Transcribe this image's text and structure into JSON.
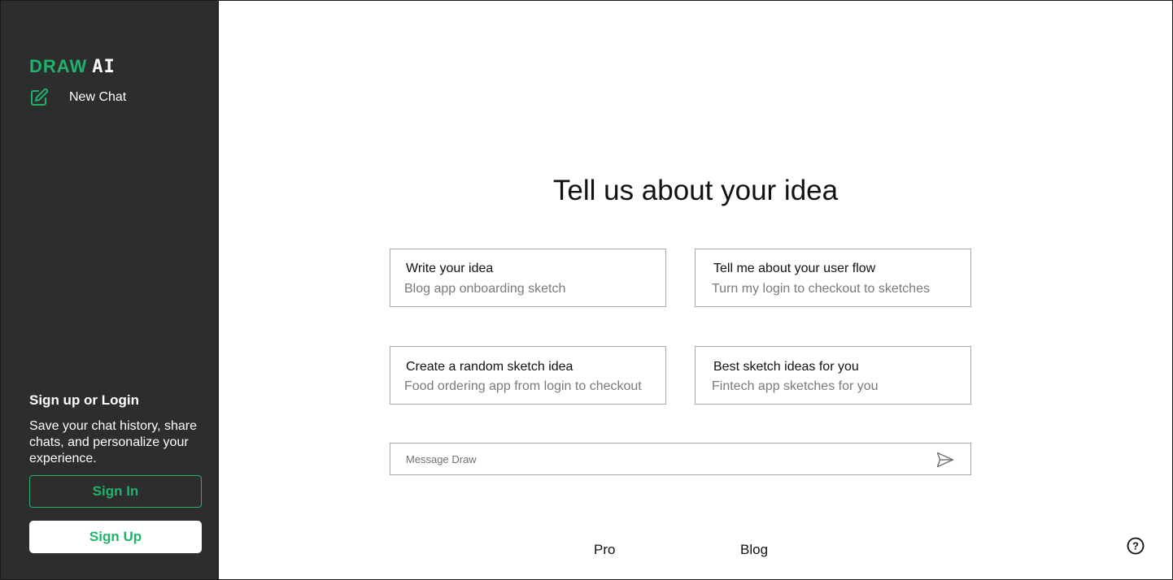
{
  "sidebar": {
    "logo_primary": "DRAW",
    "logo_secondary": "AI",
    "new_chat_label": "New Chat",
    "signup_title": "Sign up or Login",
    "signup_desc": "Save your chat history, share chats, and personalize your experience.",
    "signin_label": "Sign In",
    "signup_label": "Sign Up"
  },
  "main": {
    "headline": "Tell us about your idea",
    "cards": [
      {
        "title": "Write your idea",
        "subtitle": "Blog app onboarding sketch"
      },
      {
        "title": "Tell me about your user flow",
        "subtitle": "Turn my login to checkout to sketches"
      },
      {
        "title": "Create a random sketch idea",
        "subtitle": "Food ordering app from login to checkout"
      },
      {
        "title": "Best sketch ideas for you",
        "subtitle": "Fintech app sketches for you"
      }
    ],
    "message_placeholder": "Message Draw",
    "message_value": ""
  },
  "footer": {
    "pro_label": "Pro",
    "blog_label": "Blog"
  },
  "icons": {
    "new_chat": "edit-icon",
    "send": "send-icon",
    "help": "help-icon"
  },
  "colors": {
    "accent": "#1fb26b",
    "sidebar_bg": "#2d2d2d",
    "border": "#a8a8a8"
  }
}
